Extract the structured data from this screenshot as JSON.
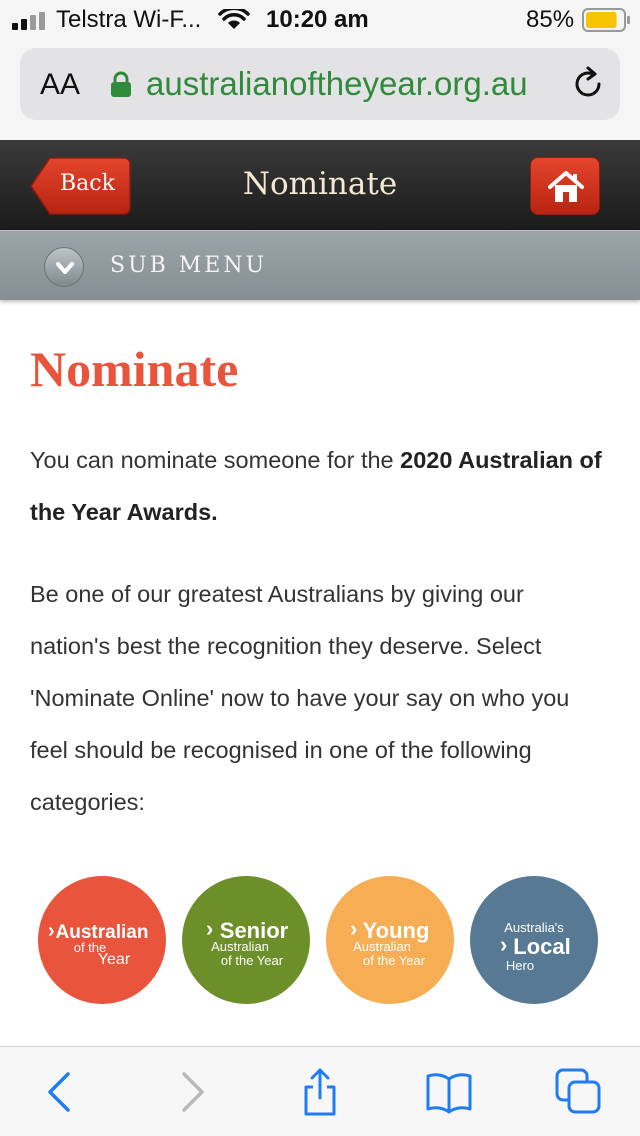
{
  "status_bar": {
    "carrier": "Telstra Wi-F...",
    "time": "10:20 am",
    "battery_percent": "85%",
    "battery_level": 0.85,
    "icons": [
      "signal-icon",
      "wifi-icon",
      "battery-icon"
    ]
  },
  "browser": {
    "text_size_label": "AA",
    "domain": "australianoftheyear.org.au",
    "secure": true,
    "icons": [
      "lock-icon",
      "reload-icon"
    ]
  },
  "site_header": {
    "back_label": "Back",
    "title": "Nominate",
    "home_icon": "home-icon"
  },
  "sub_menu": {
    "label": "SUB MENU",
    "icon": "chevron-down-icon"
  },
  "content": {
    "heading": "Nominate",
    "intro_text": "You can nominate someone for the ",
    "intro_bold": "2020 Australian of the Year Awards.",
    "body_text": "Be one of our greatest Australians by giving our nation's best the recognition they deserve. Select 'Nominate Online' now to have your say on who you feel should be recognised in one of the following categories:"
  },
  "categories": [
    {
      "line1": "Australian",
      "line2": "of the",
      "line3": "Year",
      "color": "#e8543c"
    },
    {
      "line1": "Senior",
      "line2": "Australian",
      "line3": "of the Year",
      "color": "#6d8f2a"
    },
    {
      "line1": "Young",
      "line2": "Australian",
      "line3": "of the Year",
      "color": "#f6ad54"
    },
    {
      "line1": "Australia's",
      "line2": "Local",
      "line3": "Hero",
      "color": "#587993"
    }
  ],
  "toolbar": {
    "icons": [
      "back-arrow-icon",
      "forward-arrow-icon",
      "share-icon",
      "bookmarks-icon",
      "tabs-icon"
    ]
  },
  "colors": {
    "accent": "#e8543c",
    "url_green": "#2f8a3a",
    "ios_blue": "#1f7cf5"
  }
}
